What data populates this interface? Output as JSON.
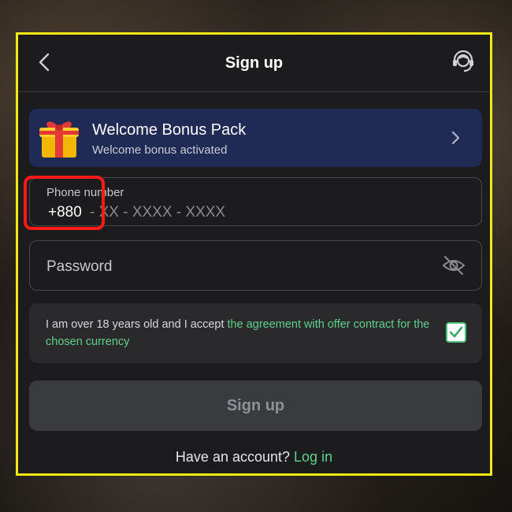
{
  "header": {
    "title": "Sign up"
  },
  "bonus": {
    "title": "Welcome Bonus Pack",
    "subtitle": "Welcome bonus activated"
  },
  "phone": {
    "label": "Phone number",
    "code": "+880",
    "mask": "- XX - XXXX - XXXX"
  },
  "password": {
    "placeholder": "Password"
  },
  "agreement": {
    "text": "I am over 18 years old and I accept ",
    "link": "the agreement with offer contract for the chosen currency",
    "checked": true
  },
  "submit": {
    "label": "Sign up"
  },
  "footer": {
    "text": "Have an account? ",
    "link": "Log in"
  },
  "colors": {
    "frame": "#f2ea12",
    "highlight": "#ff1a1a",
    "accent": "#5fd18c",
    "bonus_bg": "#1f2a55"
  }
}
